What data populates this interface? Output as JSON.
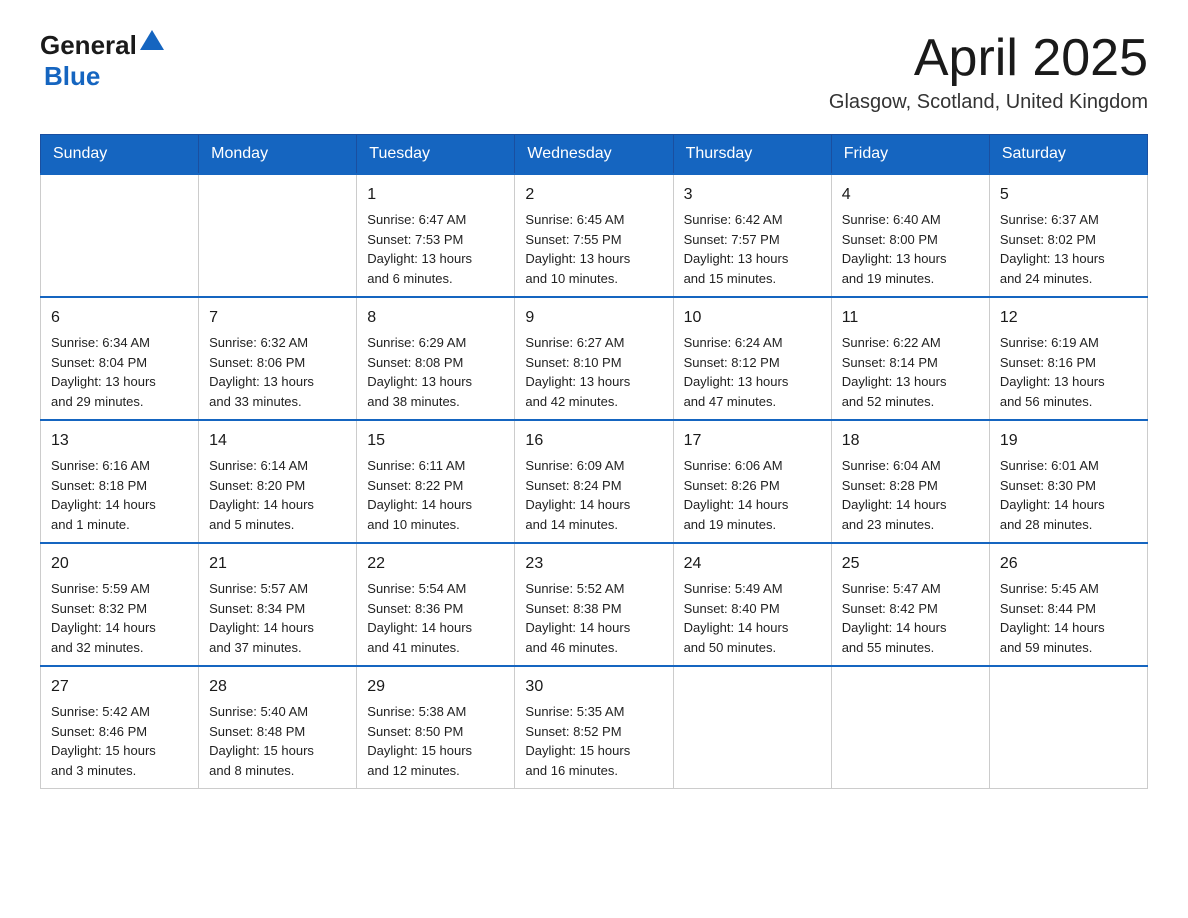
{
  "header": {
    "logo_general": "General",
    "logo_blue": "Blue",
    "title": "April 2025",
    "location": "Glasgow, Scotland, United Kingdom"
  },
  "calendar": {
    "weekdays": [
      "Sunday",
      "Monday",
      "Tuesday",
      "Wednesday",
      "Thursday",
      "Friday",
      "Saturday"
    ],
    "weeks": [
      [
        {
          "day": "",
          "info": ""
        },
        {
          "day": "",
          "info": ""
        },
        {
          "day": "1",
          "info": "Sunrise: 6:47 AM\nSunset: 7:53 PM\nDaylight: 13 hours\nand 6 minutes."
        },
        {
          "day": "2",
          "info": "Sunrise: 6:45 AM\nSunset: 7:55 PM\nDaylight: 13 hours\nand 10 minutes."
        },
        {
          "day": "3",
          "info": "Sunrise: 6:42 AM\nSunset: 7:57 PM\nDaylight: 13 hours\nand 15 minutes."
        },
        {
          "day": "4",
          "info": "Sunrise: 6:40 AM\nSunset: 8:00 PM\nDaylight: 13 hours\nand 19 minutes."
        },
        {
          "day": "5",
          "info": "Sunrise: 6:37 AM\nSunset: 8:02 PM\nDaylight: 13 hours\nand 24 minutes."
        }
      ],
      [
        {
          "day": "6",
          "info": "Sunrise: 6:34 AM\nSunset: 8:04 PM\nDaylight: 13 hours\nand 29 minutes."
        },
        {
          "day": "7",
          "info": "Sunrise: 6:32 AM\nSunset: 8:06 PM\nDaylight: 13 hours\nand 33 minutes."
        },
        {
          "day": "8",
          "info": "Sunrise: 6:29 AM\nSunset: 8:08 PM\nDaylight: 13 hours\nand 38 minutes."
        },
        {
          "day": "9",
          "info": "Sunrise: 6:27 AM\nSunset: 8:10 PM\nDaylight: 13 hours\nand 42 minutes."
        },
        {
          "day": "10",
          "info": "Sunrise: 6:24 AM\nSunset: 8:12 PM\nDaylight: 13 hours\nand 47 minutes."
        },
        {
          "day": "11",
          "info": "Sunrise: 6:22 AM\nSunset: 8:14 PM\nDaylight: 13 hours\nand 52 minutes."
        },
        {
          "day": "12",
          "info": "Sunrise: 6:19 AM\nSunset: 8:16 PM\nDaylight: 13 hours\nand 56 minutes."
        }
      ],
      [
        {
          "day": "13",
          "info": "Sunrise: 6:16 AM\nSunset: 8:18 PM\nDaylight: 14 hours\nand 1 minute."
        },
        {
          "day": "14",
          "info": "Sunrise: 6:14 AM\nSunset: 8:20 PM\nDaylight: 14 hours\nand 5 minutes."
        },
        {
          "day": "15",
          "info": "Sunrise: 6:11 AM\nSunset: 8:22 PM\nDaylight: 14 hours\nand 10 minutes."
        },
        {
          "day": "16",
          "info": "Sunrise: 6:09 AM\nSunset: 8:24 PM\nDaylight: 14 hours\nand 14 minutes."
        },
        {
          "day": "17",
          "info": "Sunrise: 6:06 AM\nSunset: 8:26 PM\nDaylight: 14 hours\nand 19 minutes."
        },
        {
          "day": "18",
          "info": "Sunrise: 6:04 AM\nSunset: 8:28 PM\nDaylight: 14 hours\nand 23 minutes."
        },
        {
          "day": "19",
          "info": "Sunrise: 6:01 AM\nSunset: 8:30 PM\nDaylight: 14 hours\nand 28 minutes."
        }
      ],
      [
        {
          "day": "20",
          "info": "Sunrise: 5:59 AM\nSunset: 8:32 PM\nDaylight: 14 hours\nand 32 minutes."
        },
        {
          "day": "21",
          "info": "Sunrise: 5:57 AM\nSunset: 8:34 PM\nDaylight: 14 hours\nand 37 minutes."
        },
        {
          "day": "22",
          "info": "Sunrise: 5:54 AM\nSunset: 8:36 PM\nDaylight: 14 hours\nand 41 minutes."
        },
        {
          "day": "23",
          "info": "Sunrise: 5:52 AM\nSunset: 8:38 PM\nDaylight: 14 hours\nand 46 minutes."
        },
        {
          "day": "24",
          "info": "Sunrise: 5:49 AM\nSunset: 8:40 PM\nDaylight: 14 hours\nand 50 minutes."
        },
        {
          "day": "25",
          "info": "Sunrise: 5:47 AM\nSunset: 8:42 PM\nDaylight: 14 hours\nand 55 minutes."
        },
        {
          "day": "26",
          "info": "Sunrise: 5:45 AM\nSunset: 8:44 PM\nDaylight: 14 hours\nand 59 minutes."
        }
      ],
      [
        {
          "day": "27",
          "info": "Sunrise: 5:42 AM\nSunset: 8:46 PM\nDaylight: 15 hours\nand 3 minutes."
        },
        {
          "day": "28",
          "info": "Sunrise: 5:40 AM\nSunset: 8:48 PM\nDaylight: 15 hours\nand 8 minutes."
        },
        {
          "day": "29",
          "info": "Sunrise: 5:38 AM\nSunset: 8:50 PM\nDaylight: 15 hours\nand 12 minutes."
        },
        {
          "day": "30",
          "info": "Sunrise: 5:35 AM\nSunset: 8:52 PM\nDaylight: 15 hours\nand 16 minutes."
        },
        {
          "day": "",
          "info": ""
        },
        {
          "day": "",
          "info": ""
        },
        {
          "day": "",
          "info": ""
        }
      ]
    ]
  }
}
